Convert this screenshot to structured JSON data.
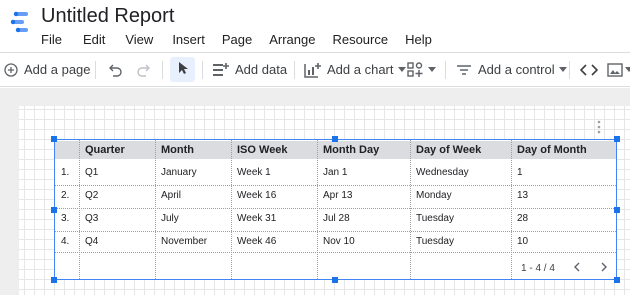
{
  "app": {
    "title": "Untitled Report",
    "menu": [
      "File",
      "Edit",
      "View",
      "Insert",
      "Page",
      "Arrange",
      "Resource",
      "Help"
    ]
  },
  "toolbar": {
    "add_page": "Add a page",
    "add_data": "Add data",
    "add_chart": "Add a chart",
    "add_control": "Add a control"
  },
  "table": {
    "headers": [
      "",
      "Quarter",
      "Month",
      "ISO Week",
      "Month Day",
      "Day of Week",
      "Day of Month"
    ],
    "rows": [
      [
        "1.",
        "Q1",
        "January",
        "Week 1",
        "Jan 1",
        "Wednesday",
        "1"
      ],
      [
        "2.",
        "Q2",
        "April",
        "Week 16",
        "Apr 13",
        "Monday",
        "13"
      ],
      [
        "3.",
        "Q3",
        "July",
        "Week 31",
        "Jul 28",
        "Tuesday",
        "28"
      ],
      [
        "4.",
        "Q4",
        "November",
        "Week 46",
        "Nov 10",
        "Tuesday",
        "10"
      ]
    ],
    "pagination": "1 - 4 / 4"
  },
  "colors": {
    "accent": "#1a73e8",
    "selection_border": "#4285f4",
    "header_bg": "#dadce0",
    "selected_tool_bg": "#e8f0fe"
  },
  "icons": [
    "data-studio-logo-icon",
    "add-page-icon",
    "undo-icon",
    "redo-icon",
    "select-cursor-icon",
    "add-data-icon",
    "add-chart-icon",
    "chevron-down-icon",
    "community-viz-icon",
    "add-control-icon",
    "code-embed-icon",
    "image-icon",
    "chevron-left-icon",
    "chevron-right-icon",
    "more-vert-icon"
  ]
}
